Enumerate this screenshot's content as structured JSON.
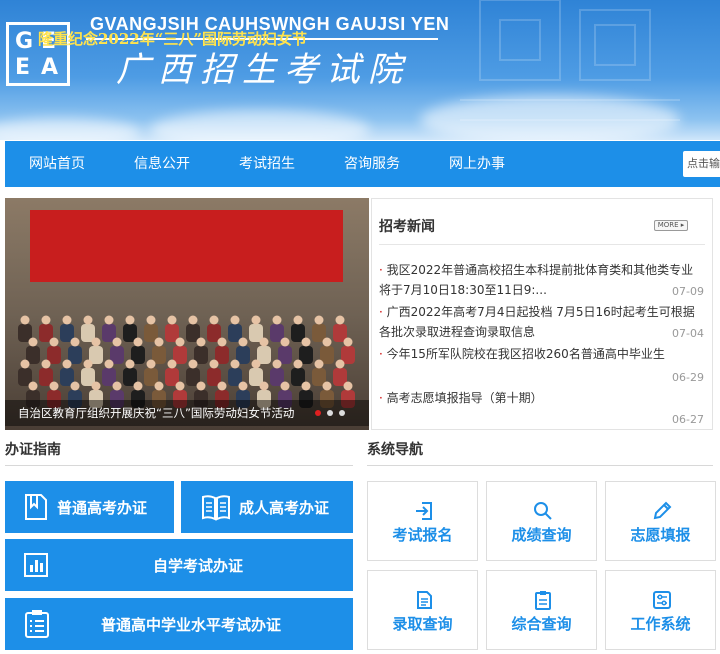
{
  "header": {
    "logo_letters": [
      "G",
      "E",
      "E",
      "A"
    ],
    "title_en": "GVANGJSIH CAUHSWNGH GAUJSI YEN",
    "title_cn": "广西招生考试院"
  },
  "nav": {
    "items": [
      "网站首页",
      "信息公开",
      "考试招生",
      "咨询服务",
      "网上办事"
    ],
    "search_placeholder": "点击输入"
  },
  "slider": {
    "banner_text": "隆重纪念2022年“三八”国际劳动妇女节",
    "caption": "自治区教育厅组织开展庆祝“三八”国际劳动妇女节活动",
    "dots": 3
  },
  "news": {
    "title": "招考新闻",
    "more_label": "MORE",
    "items": [
      {
        "text": "我区2022年普通高校招生本科提前批体育类和其他类专业将于7月10日18:30至11日9:...",
        "date": "07-09"
      },
      {
        "text": "广西2022年高考7月4日起投档 7月5日16时起考生可根据各批次录取进程查询录取信息",
        "date": "07-04"
      },
      {
        "text": "今年15所军队院校在我区招收260名普通高中毕业生",
        "date": "06-29"
      },
      {
        "text": "高考志愿填报指导（第十期）",
        "date": "06-27"
      }
    ]
  },
  "guide": {
    "title": "办证指南",
    "buttons": [
      "普通高考办证",
      "成人高考办证",
      "自学考试办证",
      "普通高中学业水平考试办证"
    ]
  },
  "system_nav": {
    "title": "系统导航",
    "tiles": [
      "考试报名",
      "成绩查询",
      "志愿填报",
      "录取查询",
      "综合查询",
      "工作系统"
    ]
  },
  "colors": {
    "primary": "#1d8fe8",
    "banner_red": "#c81e1e",
    "banner_text": "#ffe34d",
    "date_gray": "#999999"
  }
}
